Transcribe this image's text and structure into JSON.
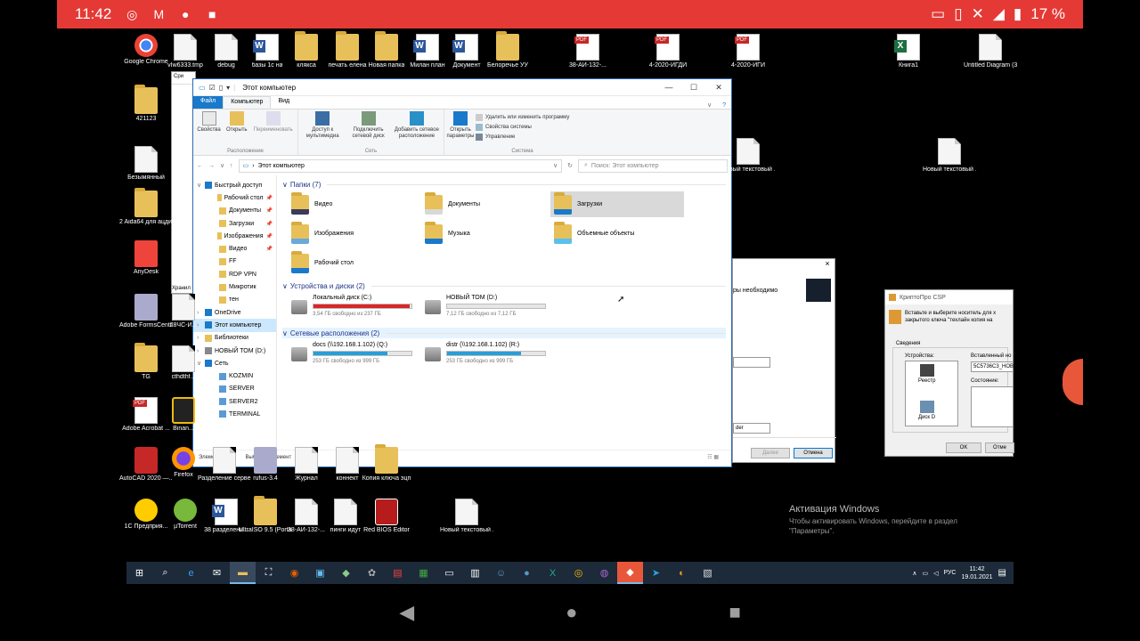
{
  "status_bar": {
    "time": "11:42",
    "battery": "17 %"
  },
  "desktop_icons": [
    {
      "label": "Google Chrome",
      "kind": "chrome"
    },
    {
      "label": "vIw6333.tmp",
      "kind": "doc"
    },
    {
      "label": "debug",
      "kind": "doc"
    },
    {
      "label": "базы 1с на",
      "kind": "word"
    },
    {
      "label": "клякса",
      "kind": "folder"
    },
    {
      "label": "печать елена",
      "kind": "folder"
    },
    {
      "label": "Новая папка",
      "kind": "folder"
    },
    {
      "label": "Милан план",
      "kind": "word"
    },
    {
      "label": "Документ",
      "kind": "word"
    },
    {
      "label": "Белоречье УУ",
      "kind": "folder"
    },
    {
      "label": "38-АИ-132-...",
      "kind": "pdf"
    },
    {
      "label": "4-2020-ИГДИ",
      "kind": "pdf"
    },
    {
      "label": "4-2020-ИГИ",
      "kind": "pdf"
    },
    {
      "label": "Книга1",
      "kind": "xls"
    },
    {
      "label": "Untitled Diagram (3)",
      "kind": "doc"
    },
    {
      "label": "421123",
      "kind": "folder"
    },
    {
      "label": "Безымянный",
      "kind": "doc"
    },
    {
      "label": "2 Aida64 для ацдитов",
      "kind": "folder"
    },
    {
      "label": "AnyDesk",
      "kind": "anydesk"
    },
    {
      "label": "Adobe FormsCentral",
      "kind": "app"
    },
    {
      "label": "28ЧС-И...",
      "kind": "doc"
    },
    {
      "label": "TG",
      "kind": "folder"
    },
    {
      "label": "cthdthf...",
      "kind": "doc"
    },
    {
      "label": "Adobe Acrobat ...",
      "kind": "pdf"
    },
    {
      "label": "Binan...",
      "kind": "binance"
    },
    {
      "label": "AutoCAD 2020 —...",
      "kind": "autocad"
    },
    {
      "label": "Firefox",
      "kind": "firefox"
    },
    {
      "label": "Разделение серверов",
      "kind": "doc"
    },
    {
      "label": "rufus-3.4",
      "kind": "app"
    },
    {
      "label": "Журнал",
      "kind": "doc"
    },
    {
      "label": "коннект",
      "kind": "doc"
    },
    {
      "label": "Копия ключа эцп",
      "kind": "folder"
    },
    {
      "label": "1С Предприя...",
      "kind": "onec"
    },
    {
      "label": "µTorrent",
      "kind": "utorrent"
    },
    {
      "label": "38 разделени...",
      "kind": "word"
    },
    {
      "label": "UltraISO 9.5 (Portable)",
      "kind": "folder"
    },
    {
      "label": "38-АИ-132-...",
      "kind": "doc"
    },
    {
      "label": "пинги идут",
      "kind": "doc"
    },
    {
      "label": "Red BIOS Editor",
      "kind": "rbe"
    },
    {
      "label": "Новый текстовый ...",
      "kind": "doc"
    },
    {
      "label": "Новый текстовый ...",
      "kind": "doc"
    },
    {
      "label": "Новый текстовый ...",
      "kind": "doc"
    }
  ],
  "watermark": {
    "title": "Активация Windows",
    "text": "Чтобы активировать Windows, перейдите в раздел \"Параметры\"."
  },
  "taskbar": {
    "lang": "РУС",
    "time": "11:42",
    "date": "19.01.2021"
  },
  "explorer": {
    "title": "Этот компьютер",
    "tabs": {
      "file": "Файл",
      "computer": "Компьютер",
      "view": "Вид"
    },
    "ribbon": {
      "properties": "Свойства",
      "open": "Открыть",
      "rename": "Переименовать",
      "group_location": "Расположение",
      "media_access": "Доступ к мультимедиа",
      "map_drive": "Подключить сетевой диск",
      "add_location": "Добавить сетевое расположение",
      "group_network": "Сеть",
      "open_settings": "Открыть параметры",
      "uninstall": "Удалить или изменить программу",
      "system_props": "Свойства системы",
      "manage": "Управление",
      "group_system": "Система"
    },
    "address": "Этот компьютер",
    "search_placeholder": "Поиск: Этот компьютер",
    "nav": [
      {
        "label": "Быстрый доступ",
        "level": 0,
        "pin": false
      },
      {
        "label": "Рабочий стол",
        "level": 1,
        "pin": true
      },
      {
        "label": "Документы",
        "level": 1,
        "pin": true
      },
      {
        "label": "Загрузки",
        "level": 1,
        "pin": true
      },
      {
        "label": "Изображения",
        "level": 1,
        "pin": true
      },
      {
        "label": "Видео",
        "level": 1,
        "pin": true
      },
      {
        "label": "FF",
        "level": 1,
        "pin": false
      },
      {
        "label": "RDP VPN",
        "level": 1,
        "pin": false
      },
      {
        "label": "Микротик",
        "level": 1,
        "pin": false
      },
      {
        "label": "тен",
        "level": 1,
        "pin": false
      },
      {
        "label": "OneDrive",
        "level": 0,
        "pin": false
      },
      {
        "label": "Этот компьютер",
        "level": 0,
        "pin": false,
        "selected": true
      },
      {
        "label": "Библиотеки",
        "level": 0,
        "pin": false
      },
      {
        "label": "НОВЫЙ ТОМ (D:)",
        "level": 0,
        "pin": false
      },
      {
        "label": "Сеть",
        "level": 0,
        "pin": false
      },
      {
        "label": "KOZMIN",
        "level": 1,
        "pin": false
      },
      {
        "label": "SERVER",
        "level": 1,
        "pin": false
      },
      {
        "label": "SERVER2",
        "level": 1,
        "pin": false
      },
      {
        "label": "TERMINAL",
        "level": 1,
        "pin": false
      }
    ],
    "folders_header": "Папки (7)",
    "folders": [
      {
        "label": "Видео"
      },
      {
        "label": "Документы"
      },
      {
        "label": "Загрузки",
        "selected": true
      },
      {
        "label": "Изображения"
      },
      {
        "label": "Музыка"
      },
      {
        "label": "Объемные объекты"
      },
      {
        "label": "Рабочий стол"
      }
    ],
    "devices_header": "Устройства и диски (2)",
    "devices": [
      {
        "label": "Локальный диск (C:)",
        "free": "3,54 ГБ свободно из 237 ГБ",
        "fill": 0.985,
        "color": "#da2626"
      },
      {
        "label": "НОВЫЙ ТОМ (D:)",
        "free": "7,12 ГБ свободно из 7,12 ГБ",
        "fill": 0.0,
        "color": "#26a0da"
      }
    ],
    "network_header": "Сетевые расположения (2)",
    "network": [
      {
        "label": "docs (\\\\192.168.1.102) (Q:)",
        "free": "253 ГБ свободно из 999 ГБ",
        "fill": 0.75,
        "color": "#26a0da"
      },
      {
        "label": "distr (\\\\192.168.1.102) (R:)",
        "free": "253 ГБ свободно из 999 ГБ",
        "fill": 0.75,
        "color": "#26a0da"
      }
    ],
    "status_items": "Элементов: 11",
    "status_selected": "Выбран 1 элемент"
  },
  "bg_dialog": {
    "text": "ры необходимо",
    "field": "der",
    "next": "Далее",
    "cancel": "Отмена"
  },
  "crypto": {
    "title": "КриптоПро CSP",
    "text": "Вставьте и выберите носитель для х закрытого ключа \"техлайн копия на",
    "info": "Сведения",
    "devices": "Устройства:",
    "reader": "Реестр",
    "disk": "Диск D",
    "inserted": "Вставленный но",
    "serial": "5C5736C3_НОВ",
    "state": "Состояние:",
    "ok": "OK",
    "cancel": "Отме"
  },
  "bg_window": {
    "title": "Сри",
    "addr": "Хранил"
  }
}
